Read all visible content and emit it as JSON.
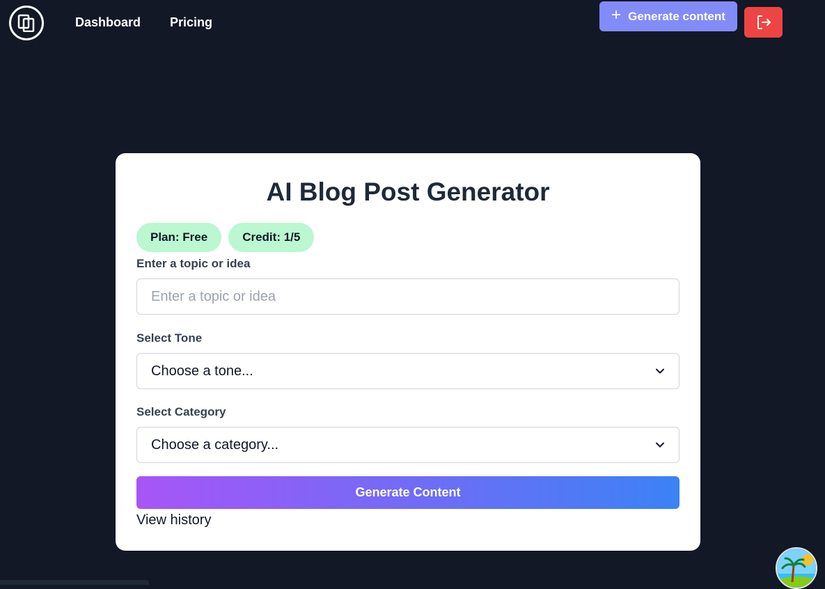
{
  "nav": {
    "links": [
      {
        "label": "Dashboard"
      },
      {
        "label": "Pricing"
      }
    ],
    "generate_button_label": "Generate content"
  },
  "card": {
    "title": "AI Blog Post Generator",
    "badges": {
      "plan": "Plan: Free",
      "credit": "Credit: 1/5"
    },
    "topic": {
      "label": "Enter a topic or idea",
      "placeholder": "Enter a topic or idea",
      "value": ""
    },
    "tone": {
      "label": "Select Tone",
      "selected": "Choose a tone..."
    },
    "category": {
      "label": "Select Category",
      "selected": "Choose a category..."
    },
    "generate_button_label": "Generate Content",
    "history_link_label": "View history"
  },
  "colors": {
    "background": "#121826",
    "accent_button": "#818cf8",
    "logout_button": "#ef4444",
    "badge": "#bbf7d0",
    "gradient_start": "#a855f7",
    "gradient_end": "#3b82f6"
  },
  "icons": {
    "logo": "copy-logo-icon",
    "generate": "plus-icon",
    "logout": "logout-icon",
    "select": "chevron-down-icon"
  }
}
